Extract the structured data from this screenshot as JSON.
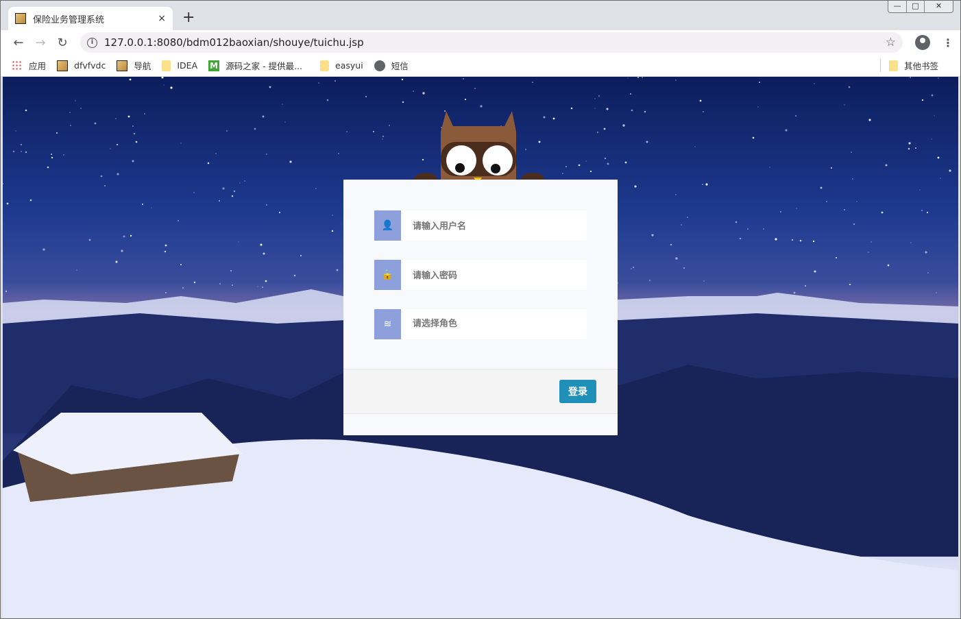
{
  "browser": {
    "tab_title": "保险业务管理系统",
    "tab_close": "×",
    "new_tab": "+",
    "window_controls": [
      "—",
      "□",
      "✕"
    ],
    "url": "127.0.0.1:8080/bdm012baoxian/shouye/tuichu.jsp",
    "bookmarks": [
      {
        "label": "应用",
        "icon": "apps-icon"
      },
      {
        "label": "dfvfvdc",
        "icon": "image-icon"
      },
      {
        "label": "导航",
        "icon": "image-icon"
      },
      {
        "label": "IDEA",
        "icon": "folder-icon"
      },
      {
        "label": "源码之家 - 提供最...",
        "icon": "m-icon"
      },
      {
        "label": "easyui",
        "icon": "folder-icon"
      },
      {
        "label": "短信",
        "icon": "globe-icon"
      }
    ],
    "other_bookmarks": "其他书签"
  },
  "login": {
    "username_placeholder": "请输入用户名",
    "password_placeholder": "请输入密码",
    "role_placeholder": "请选择角色",
    "submit_label": "登录",
    "accent": "#2190b9",
    "icon_bg": "#8da0dc"
  }
}
